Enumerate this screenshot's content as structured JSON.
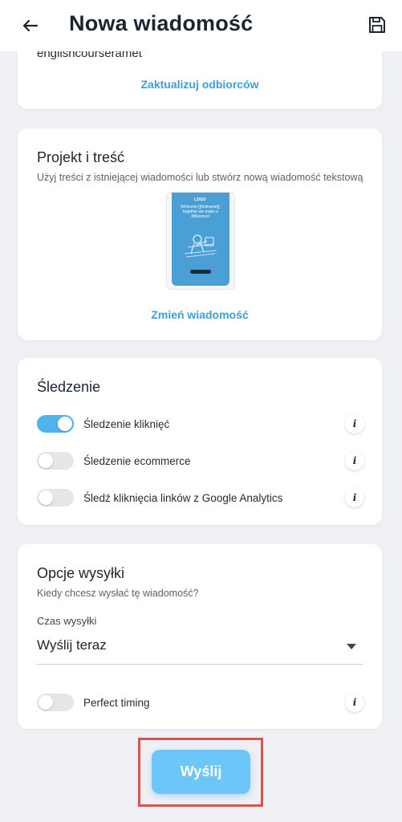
{
  "header": {
    "title": "Nowa wiadomość",
    "back_icon": "arrow-left-icon",
    "save_icon": "save-icon"
  },
  "recipients": {
    "partial_text": "englishcourseramet",
    "update_link": "Zaktualizuj odbiorców"
  },
  "design": {
    "title": "Projekt i treść",
    "subtitle": "Użyj treści z istniejącej wiadomości lub stwórz nową wiadomość tekstową",
    "thumbnail": {
      "logo": "LOGO",
      "headline": "Welcome [[firstname]], together we make a difference!",
      "accent_color": "#4a9fd4"
    },
    "change_link": "Zmień wiadomość"
  },
  "tracking": {
    "title": "Śledzenie",
    "items": [
      {
        "label": "Śledzenie kliknięć",
        "enabled": true
      },
      {
        "label": "Śledzenie ecommerce",
        "enabled": false
      },
      {
        "label": "Śledź kliknięcia linków z Google Analytics",
        "enabled": false
      }
    ]
  },
  "sending": {
    "title": "Opcje wysyłki",
    "subtitle": "Kiedy chcesz wysłać tę wiadomość?",
    "time_label": "Czas wysyłki",
    "time_value": "Wyślij teraz",
    "perfect_timing": {
      "label": "Perfect timing",
      "enabled": false
    }
  },
  "send_button": "Wyślij",
  "colors": {
    "accent": "#3a9fd8",
    "toggle_on": "#4fb3ee",
    "send_button": "#6cc6f7",
    "highlight_box": "#d9534f"
  }
}
